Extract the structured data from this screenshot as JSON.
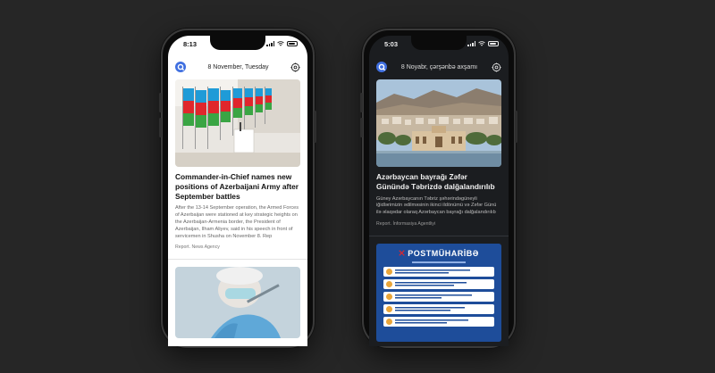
{
  "phones": {
    "light": {
      "status_time": "8:13",
      "date": "8 November, Tuesday",
      "articles": [
        {
          "title": "Commander-in-Chief names new positions of Azerbaijani Army after September battles",
          "body": "After the 13-14 September operation, the Armed Forces of Azerbaijan were stationed at key strategic heights on the Azerbaijan-Armenia border, the President of Azerbaijan, Ilham Aliyev, said in his speech in front of servicemen in Shusha on November 8. Rep",
          "source": "Report. News Agency"
        }
      ]
    },
    "dark": {
      "status_time": "5:03",
      "date": "8 Noyabr, çərşənbə axşamı",
      "articles": [
        {
          "title": "Azərbaycan bayrağı Zəfər Günündə Təbrizdə dalğalandırılıb",
          "body": "Güney Azərbaycanın Təbriz şəhərindəgüneyli iğidlərimizin ədilməsinin ikinci ildönümü və Zəfər Günü ilə əlaqədar olaraq Azərbaycan bayrağı dalğalandırılıb",
          "source": "Report. İnformasiya Agentliyi"
        }
      ],
      "poster": {
        "title": "POSTMÜHARİBƏ"
      }
    }
  },
  "colors": {
    "background": "#262626",
    "light_screen": "#ffffff",
    "dark_screen": "#1b1d20",
    "brand_blue": "#3f6fe0",
    "poster_blue": "#1e4d9a"
  },
  "icons": {
    "logo": "report-logo-icon",
    "settings": "settings-icon"
  }
}
